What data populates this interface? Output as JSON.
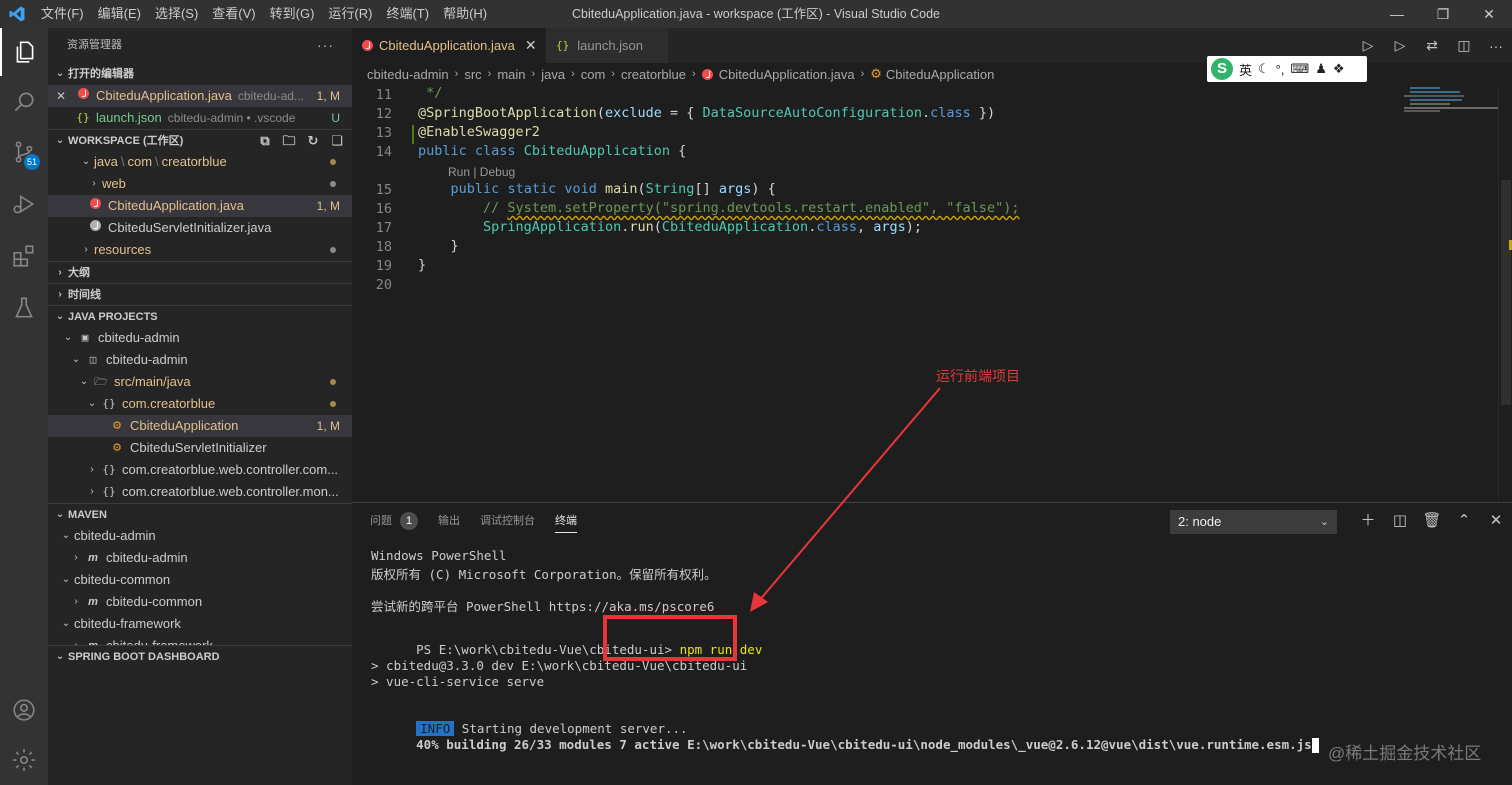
{
  "window": {
    "title": "CbiteduApplication.java - workspace (工作区) - Visual Studio Code",
    "menu": [
      "文件(F)",
      "编辑(E)",
      "选择(S)",
      "查看(V)",
      "转到(G)",
      "运行(R)",
      "终端(T)",
      "帮助(H)"
    ]
  },
  "activity_bar": {
    "scm_badge": "51"
  },
  "sidebar": {
    "title": "资源管理器",
    "open_editors": {
      "header": "打开的编辑器",
      "items": [
        {
          "name": "CbiteduApplication.java",
          "desc": "cbitedu-ad...",
          "status": "1, M"
        },
        {
          "name": "launch.json",
          "desc": "cbitedu-admin • .vscode",
          "status": "U"
        }
      ]
    },
    "workspace": {
      "header": "WORKSPACE (工作区)",
      "path_parts": [
        "java",
        "com",
        "creatorblue"
      ],
      "items": [
        {
          "name": "web"
        },
        {
          "name": "CbiteduApplication.java",
          "status": "1, M"
        },
        {
          "name": "CbiteduServletInitializer.java"
        },
        {
          "name": "resources"
        }
      ]
    },
    "outline_header": "大纲",
    "timeline_header": "时间线",
    "java_projects": {
      "header": "JAVA PROJECTS",
      "items": [
        {
          "name": "cbitedu-admin"
        },
        {
          "name": "cbitedu-admin"
        },
        {
          "name": "src/main/java"
        },
        {
          "name": "com.creatorblue"
        },
        {
          "name": "CbiteduApplication",
          "status": "1, M"
        },
        {
          "name": "CbiteduServletInitializer"
        },
        {
          "name": "com.creatorblue.web.controller.com..."
        },
        {
          "name": "com.creatorblue.web.controller.mon..."
        }
      ]
    },
    "maven": {
      "header": "MAVEN",
      "items": [
        {
          "name": "cbitedu-admin"
        },
        {
          "name": "cbitedu-admin"
        },
        {
          "name": "cbitedu-common"
        },
        {
          "name": "cbitedu-common"
        },
        {
          "name": "cbitedu-framework"
        },
        {
          "name": "cbitedu-framework"
        }
      ]
    },
    "spring_header": "SPRING BOOT DASHBOARD"
  },
  "tabs": [
    {
      "label": "CbiteduApplication.java",
      "active": true
    },
    {
      "label": "launch.json",
      "active": false
    }
  ],
  "breadcrumb": [
    "cbitedu-admin",
    "src",
    "main",
    "java",
    "com",
    "creatorblue",
    "CbiteduApplication.java",
    "CbiteduApplication"
  ],
  "ime": {
    "label": "英"
  },
  "code": {
    "line_numbers": [
      "11",
      "12",
      "13",
      "14",
      "15",
      "16",
      "17",
      "18",
      "19",
      "20"
    ],
    "codelens": "Run | Debug"
  },
  "panel": {
    "tabs": [
      {
        "label": "问题",
        "badge": "1"
      },
      {
        "label": "输出"
      },
      {
        "label": "调试控制台"
      },
      {
        "label": "终端"
      }
    ],
    "terminal_select": "2: node",
    "terminal": {
      "line1": "Windows PowerShell",
      "line2": "版权所有 (C) Microsoft Corporation。保留所有权利。",
      "line3": "尝试新的跨平台 PowerShell https://aka.ms/pscore6",
      "prompt": "PS E:\\work\\cbitedu-Vue\\cbitedu-ui> ",
      "command": "npm run dev",
      "out1": "> cbitedu@3.3.0 dev E:\\work\\cbitedu-Vue\\cbitedu-ui",
      "out2": "> vue-cli-service serve",
      "info_tag": "INFO",
      "info_text": " Starting development server...",
      "build": "40% building 26/33 modules 7 active E:\\work\\cbitedu-Vue\\cbitedu-ui\\node_modules\\_vue@2.6.12@vue\\dist\\vue.runtime.esm.js"
    }
  },
  "annotation": {
    "label": "运行前端项目",
    "color": "#e8343a"
  },
  "watermark": "@稀土掘金技术社区"
}
